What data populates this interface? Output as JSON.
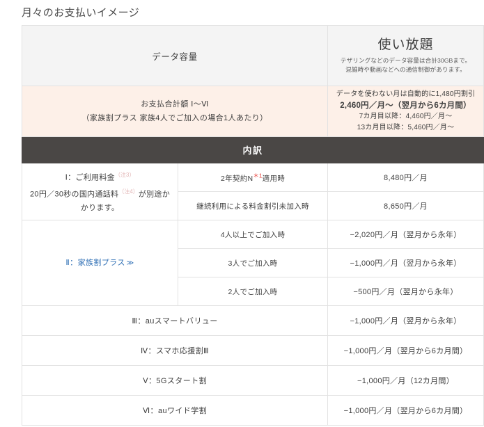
{
  "page_title": "月々のお支払いイメージ",
  "header": {
    "left_label": "データ容量",
    "right_title": "使い放題",
    "right_note_line1": "テザリングなどのデータ容量は合計30GBまで。",
    "right_note_line2": "混雑時や動画などへの通信制御があります。"
  },
  "total_row": {
    "label_line1": "お支払合計額 Ⅰ〜Ⅵ",
    "label_line2": "（家族割プラス 家族4人でご加入の場合1人あたり）",
    "value_line1": "データを使わない月は自動的に1,480円割引",
    "value_line2": "2,460円／月〜（翌月から6カ月間）",
    "value_line3": "7カ月目以降：4,460円／月〜",
    "value_line4": "13カ月目以降：5,460円／月〜"
  },
  "band_label": "内訳",
  "breakdown": {
    "row1": {
      "label_main": "Ⅰ：ご利用料金",
      "label_footnote": "（注3）",
      "label_sub_a": "20円／30秒の国内通話料",
      "label_sub_footnote": "（注4）",
      "label_sub_b": "が別途かかります。",
      "items": [
        {
          "condition": "2年契約N",
          "condition_footnote": "＊1",
          "condition_tail": "適用時",
          "value": "8,480円／月"
        },
        {
          "condition": "継続利用による料金割引未加入時",
          "condition_footnote": "",
          "condition_tail": "",
          "value": "8,650円／月"
        }
      ]
    },
    "row2": {
      "label": "Ⅱ：家族割プラス",
      "label_chevron": "≫",
      "items": [
        {
          "condition": "4人以上でご加入時",
          "value": "−2,020円／月（翌月から永年）"
        },
        {
          "condition": "3人でご加入時",
          "value": "−1,000円／月（翌月から永年）"
        },
        {
          "condition": "2人でご加入時",
          "value": "−500円／月（翌月から永年）"
        }
      ]
    },
    "simple_rows": [
      {
        "label": "Ⅲ：auスマートバリュー",
        "value": "−1,000円／月（翌月から永年）"
      },
      {
        "label": "Ⅳ：スマホ応援割Ⅲ",
        "value": "−1,000円／月（翌月から6カ月間）"
      },
      {
        "label": "Ⅴ：5Gスタート割",
        "value": "−1,000円／月（12カ月間）"
      },
      {
        "label": "Ⅵ：auワイド学割",
        "value": "−1,000円／月（翌月から6カ月間）"
      }
    ]
  },
  "colors": {
    "band_bg": "#4a4745",
    "total_bg": "#fdf0e8",
    "header_bg": "#f4f4f4",
    "link": "#2f6fb5",
    "footnote_red": "#e8403a",
    "footnote_pink": "#e3b7b7",
    "border": "#e2e2e2"
  }
}
